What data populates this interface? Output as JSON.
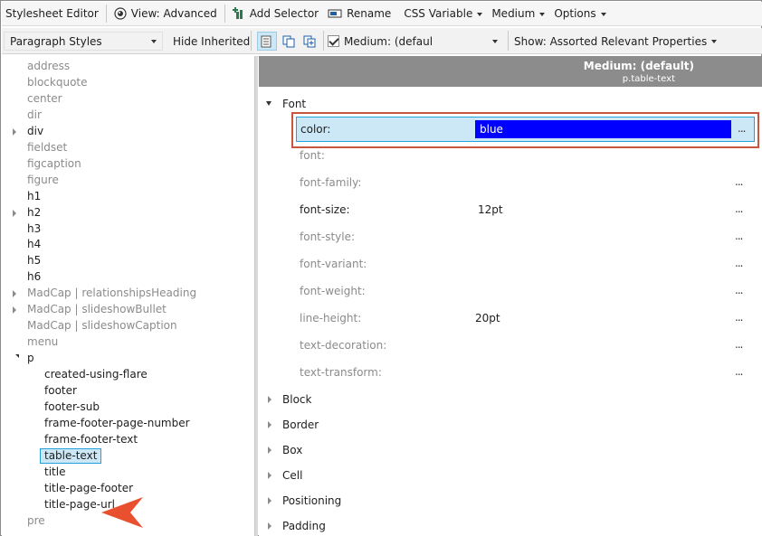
{
  "toolbar": {
    "title": "Stylesheet Editor",
    "view_label": "View: Advanced",
    "add_selector_label": "Add Selector",
    "rename_label": "Rename",
    "css_variable_label": "CSS Variable",
    "medium_label": "Medium",
    "options_label": "Options"
  },
  "toolbar2": {
    "style_type": "Paragraph Styles",
    "hide_inherited_label": "Hide Inherited",
    "medium_checkbox_label": "Medium: (default)",
    "show_label": "Show: Assorted Relevant Properties"
  },
  "tree": {
    "items": [
      {
        "label": "address"
      },
      {
        "label": "blockquote"
      },
      {
        "label": "center"
      },
      {
        "label": "dir"
      },
      {
        "label": "div"
      },
      {
        "label": "fieldset"
      },
      {
        "label": "figcaption"
      },
      {
        "label": "figure"
      },
      {
        "label": "h1"
      },
      {
        "label": "h2"
      },
      {
        "label": "h3"
      },
      {
        "label": "h4"
      },
      {
        "label": "h5"
      },
      {
        "label": "h6"
      },
      {
        "label": "MadCap | relationshipsHeading"
      },
      {
        "label": "MadCap | slideshowBullet"
      },
      {
        "label": "MadCap | slideshowCaption"
      },
      {
        "label": "menu"
      },
      {
        "label": "p"
      },
      {
        "label": "created-using-flare"
      },
      {
        "label": "footer"
      },
      {
        "label": "footer-sub"
      },
      {
        "label": "frame-footer-page-number"
      },
      {
        "label": "frame-footer-text"
      },
      {
        "label": "table-text"
      },
      {
        "label": "title"
      },
      {
        "label": "title-page-footer"
      },
      {
        "label": "title-page-url"
      },
      {
        "label": "pre"
      }
    ]
  },
  "grid": {
    "header_medium": "Medium: (default)",
    "header_selector": "p.table-text",
    "font_category": "Font",
    "highlighted": {
      "name": "color:",
      "value": "blue",
      "swatch_color": "#0000ff"
    },
    "properties": [
      {
        "name": "font:",
        "value": ""
      },
      {
        "name": "font-family:",
        "value": ""
      },
      {
        "name": "font-size:",
        "value": "12pt"
      },
      {
        "name": "font-style:",
        "value": ""
      },
      {
        "name": "font-variant:",
        "value": ""
      },
      {
        "name": "font-weight:",
        "value": ""
      },
      {
        "name": "line-height:",
        "value": "20pt"
      },
      {
        "name": "text-decoration:",
        "value": ""
      },
      {
        "name": "text-transform:",
        "value": ""
      }
    ],
    "ellipsis": "...",
    "categories": [
      {
        "label": "Block"
      },
      {
        "label": "Border"
      },
      {
        "label": "Box"
      },
      {
        "label": "Cell"
      },
      {
        "label": "Positioning"
      },
      {
        "label": "Padding"
      }
    ]
  },
  "colors": {
    "accent_arrow": "#e8502f",
    "selection": "#cce8f7",
    "highlight_border": "#c8553d"
  }
}
